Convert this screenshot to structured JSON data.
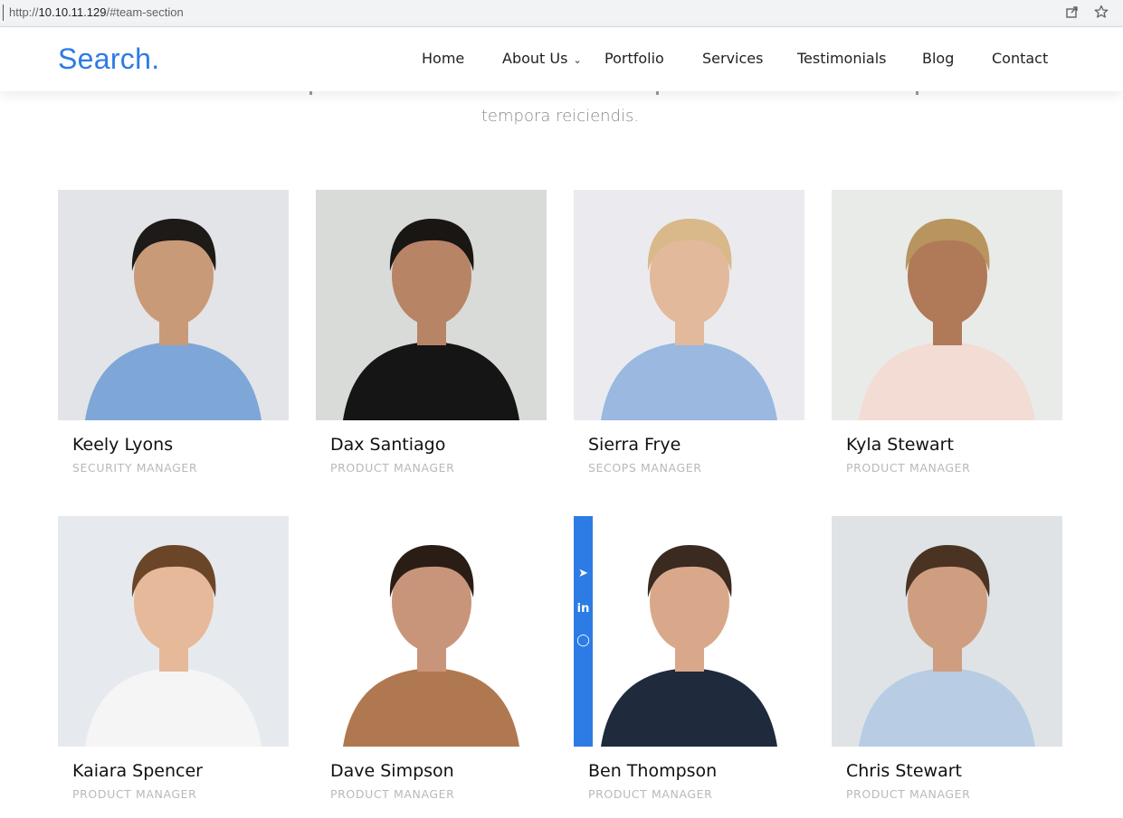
{
  "browser": {
    "url_scheme": "http://",
    "url_host": "10.10.11.129",
    "url_path": "/#team-section"
  },
  "header": {
    "logo": "Search.",
    "nav": [
      {
        "label": "Home"
      },
      {
        "label": "About Us",
        "has_dropdown": true
      },
      {
        "label": "Portfolio"
      },
      {
        "label": "Services"
      },
      {
        "label": "Testimonials"
      },
      {
        "label": "Blog"
      },
      {
        "label": "Contact"
      }
    ]
  },
  "intro": {
    "text": "tempora reiciendis."
  },
  "team": [
    {
      "name": "Keely Lyons",
      "role": "SECURITY MANAGER",
      "bg": "#e3e4e8",
      "shirt": "#7ea7d8",
      "skin": "#c99a78",
      "hair": "#1e1a18"
    },
    {
      "name": "Dax Santiago",
      "role": "PRODUCT MANAGER",
      "bg": "#d9dbd8",
      "shirt": "#151515",
      "skin": "#b88466",
      "hair": "#1a1614"
    },
    {
      "name": "Sierra Frye",
      "role": "SECOPS MANAGER",
      "bg": "#ebebef",
      "shirt": "#9ab8e0",
      "skin": "#e3b99c",
      "hair": "#d9b88a"
    },
    {
      "name": "Kyla Stewart",
      "role": "PRODUCT MANAGER",
      "bg": "#e9ebe8",
      "shirt": "#f2dcd4",
      "skin": "#b07a58",
      "hair": "#b8955e"
    },
    {
      "name": "Kaiara Spencer",
      "role": "PRODUCT MANAGER",
      "bg": "#e6eaee",
      "shirt": "#f5f5f5",
      "skin": "#e6b99a",
      "hair": "#6b4528"
    },
    {
      "name": "Dave Simpson",
      "role": "PRODUCT MANAGER",
      "bg": "#ffffff",
      "shirt": "#b07850",
      "skin": "#c9957a",
      "hair": "#2a1d16"
    },
    {
      "name": "Ben Thompson",
      "role": "PRODUCT MANAGER",
      "bg": "#ffffff",
      "shirt": "#1f2a3d",
      "skin": "#d9a88a",
      "hair": "#3a2a20"
    },
    {
      "name": "Chris Stewart",
      "role": "PRODUCT MANAGER",
      "bg": "#dfe3e6",
      "shirt": "#b8cde4",
      "skin": "#cf9e80",
      "hair": "#4a3322"
    }
  ],
  "colors": {
    "accent": "#2d7be5",
    "role_text": "#b9b9b9",
    "intro_text": "#8a8a8a"
  }
}
